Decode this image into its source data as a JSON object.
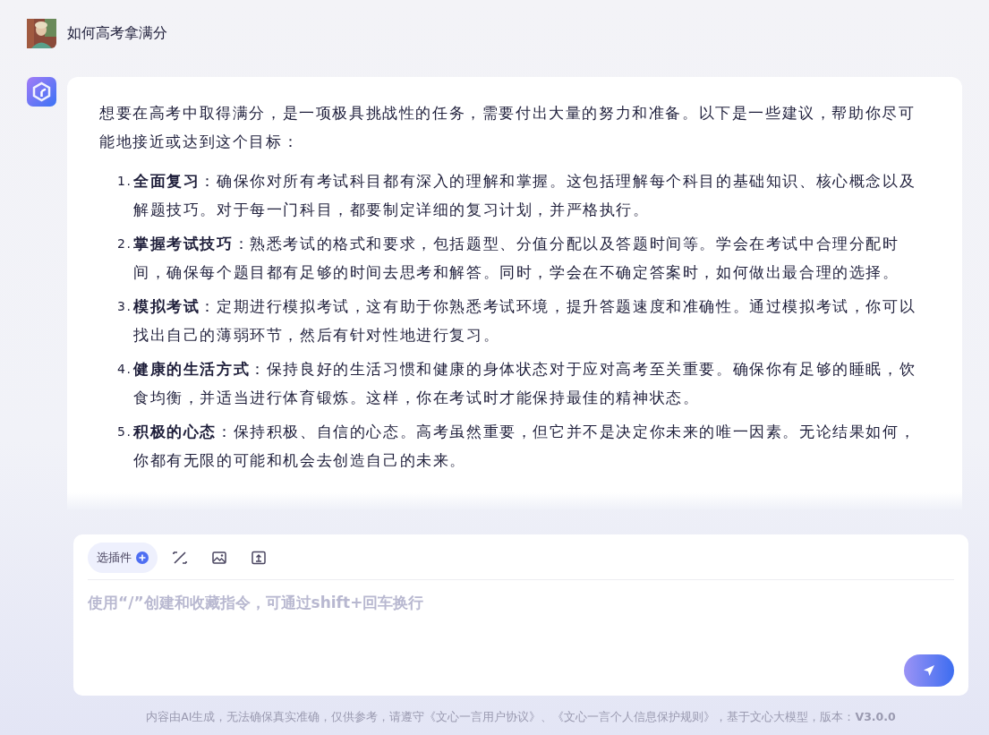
{
  "question": {
    "text": "如何高考拿满分"
  },
  "answer": {
    "intro": "想要在高考中取得满分，是一项极具挑战性的任务，需要付出大量的努力和准备。以下是一些建议，帮助你尽可能地接近或达到这个目标：",
    "items": [
      {
        "number": "1.",
        "text": "**全面复习**：确保你对所有考试科目都有深入的理解和掌握。这包括理解每个科目的基础知识、核心概念以及解题技巧。对于每一门科目，都要制定详细的复习计划，并严格执行。"
      },
      {
        "number": "2.",
        "text": "**掌握考试技巧**：熟悉考试的格式和要求，包括题型、分值分配以及答题时间等。学会在考试中合理分配时间，确保每个题目都有足够的时间去思考和解答。同时，学会在不确定答案时，如何做出最合理的选择。"
      },
      {
        "number": "3.",
        "text": "**模拟考试**：定期进行模拟考试，这有助于你熟悉考试环境，提升答题速度和准确性。通过模拟考试，你可以找出自己的薄弱环节，然后有针对性地进行复习。"
      },
      {
        "number": "4.",
        "text": "**健康的生活方式**：保持良好的生活习惯和健康的身体状态对于应对高考至关重要。确保你有足够的睡眠，饮食均衡，并适当进行体育锻炼。这样，你在考试时才能保持最佳的精神状态。"
      },
      {
        "number": "5.",
        "text": "**积极的心态**：保持积极、自信的心态。高考虽然重要，但它并不是决定你未来的唯一因素。无论结果如何，你都有无限的可能和机会去创造自己的未来。"
      }
    ]
  },
  "composer": {
    "plugin_button": "选插件",
    "placeholder": "使用“/”创建和收藏指令，可通过shift+回车换行"
  },
  "footer": "内容由AI生成，无法确保真实准确，仅供参考，请遵守《文心一言用户协议》、《文心一言个人信息保护规则》，基于文心大模型，版本：**V3.0.0**"
}
